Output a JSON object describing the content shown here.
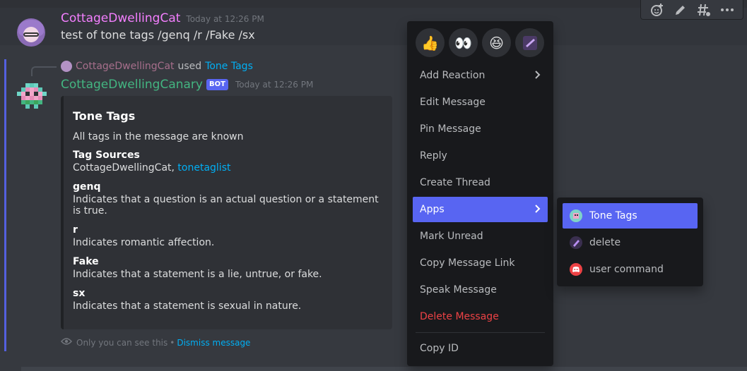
{
  "top_message": {
    "username": "CottageDwellingCat",
    "username_color": "#f47fff",
    "timestamp": "Today at 12:26 PM",
    "text": "test of tone tags /genq /r /Fake /sx"
  },
  "toolbar": {
    "icons": [
      "add-reaction-icon",
      "edit-icon",
      "thread-icon",
      "more-icon"
    ]
  },
  "reply": {
    "user": "CottageDwellingCat",
    "used": "used",
    "command": "Tone Tags"
  },
  "bot_message": {
    "username": "CottageDwellingCanary",
    "username_color": "#43b581",
    "bot_tag": "BOT",
    "timestamp": "Today at 12:26 PM"
  },
  "embed": {
    "title": "Tone Tags",
    "description": "All tags in the message are known",
    "fields": [
      {
        "name": "Tag Sources",
        "value": "CottageDwellingCat, ",
        "link": "tonetaglist"
      },
      {
        "name": "genq",
        "value": "Indicates that a question is an actual question or a statement is true."
      },
      {
        "name": "r",
        "value": "Indicates romantic affection."
      },
      {
        "name": "Fake",
        "value": "Indicates that a statement is a lie, untrue, or fake."
      },
      {
        "name": "sx",
        "value": "Indicates that a statement is sexual in nature."
      }
    ]
  },
  "ephemeral": {
    "text": "Only you can see this",
    "dot": "•",
    "dismiss": "Dismiss message"
  },
  "context_menu": {
    "reactions": [
      "👍",
      "👀",
      "😆",
      "✔"
    ],
    "items": [
      {
        "label": "Add Reaction",
        "submenu": true
      },
      {
        "label": "Edit Message"
      },
      {
        "label": "Pin Message"
      },
      {
        "label": "Reply"
      },
      {
        "label": "Create Thread"
      },
      {
        "label": "Apps",
        "submenu": true,
        "active": true
      },
      {
        "label": "Mark Unread"
      },
      {
        "label": "Copy Message Link"
      },
      {
        "label": "Speak Message"
      },
      {
        "label": "Delete Message",
        "danger": true
      }
    ],
    "copy_id": "Copy ID"
  },
  "apps_submenu": {
    "items": [
      {
        "label": "Tone Tags",
        "active": true
      },
      {
        "label": "delete"
      },
      {
        "label": "user command"
      }
    ]
  },
  "colors": {
    "accent": "#5865f2",
    "danger": "#ed4245",
    "link": "#00aff4"
  }
}
